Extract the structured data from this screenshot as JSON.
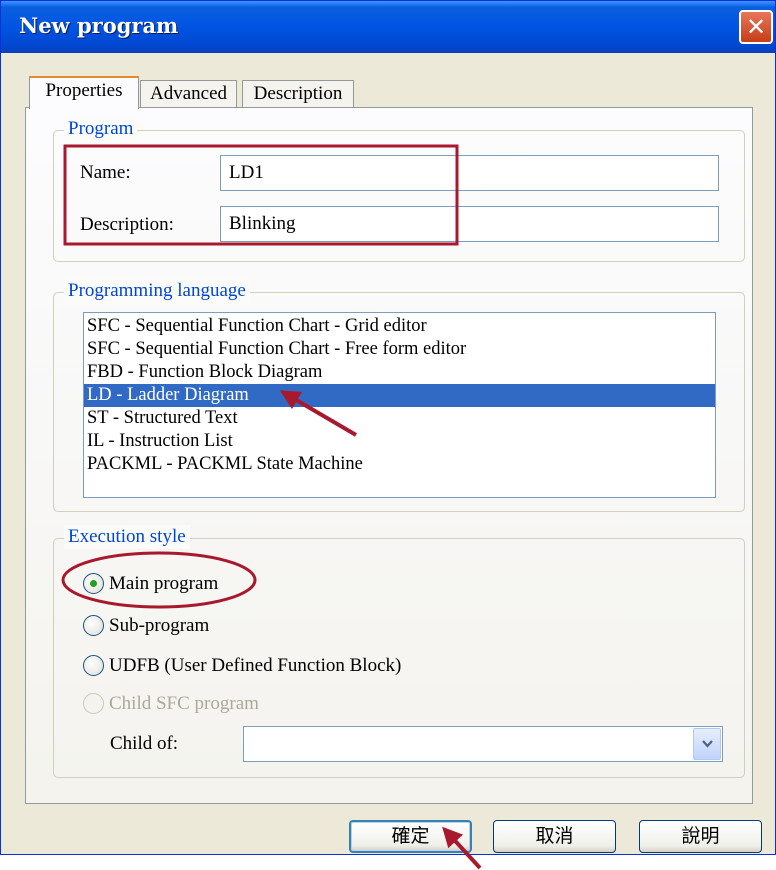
{
  "window": {
    "title": "New program",
    "close_glyph": "✕"
  },
  "tabs": [
    {
      "label": "Properties",
      "active": true
    },
    {
      "label": "Advanced",
      "active": false
    },
    {
      "label": "Description",
      "active": false
    }
  ],
  "program_group": {
    "legend": "Program",
    "name_label": "Name:",
    "name_value": "LD1",
    "description_label": "Description:",
    "description_value": "Blinking"
  },
  "language_group": {
    "legend": "Programming language",
    "items": [
      "SFC - Sequential Function Chart - Grid editor",
      "SFC - Sequential Function Chart - Free form editor",
      "FBD - Function Block Diagram",
      "LD - Ladder Diagram",
      "ST - Structured Text",
      "IL - Instruction List",
      "PACKML - PACKML State Machine"
    ],
    "selected_index": 3
  },
  "execution_group": {
    "legend": "Execution style",
    "options": [
      {
        "label": "Main program",
        "checked": true,
        "enabled": true
      },
      {
        "label": "Sub-program",
        "checked": false,
        "enabled": true
      },
      {
        "label": "UDFB (User Defined Function Block)",
        "checked": false,
        "enabled": true
      },
      {
        "label": "Child SFC program",
        "checked": false,
        "enabled": false
      }
    ],
    "child_of_label": "Child of:",
    "child_of_value": ""
  },
  "buttons": {
    "ok": "確定",
    "cancel": "取消",
    "help": "說明"
  },
  "annotation_colors": {
    "highlight": "#a8192e",
    "selection": "#316ac5",
    "title_bar": "#0054e3",
    "group_legend": "#0046d5"
  }
}
